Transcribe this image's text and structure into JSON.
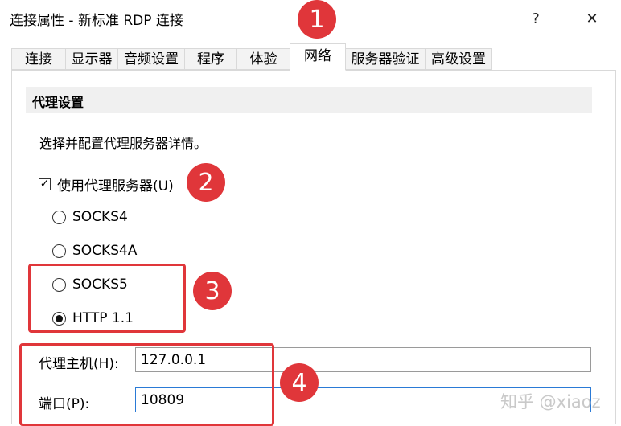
{
  "window": {
    "title": "连接属性 - 新标准 RDP 连接",
    "help_label": "?",
    "close_label": "✕"
  },
  "tabs": [
    {
      "label": "连接"
    },
    {
      "label": "显示器"
    },
    {
      "label": "音频设置"
    },
    {
      "label": "程序"
    },
    {
      "label": "体验"
    },
    {
      "label": "网络"
    },
    {
      "label": "服务器验证"
    },
    {
      "label": "高级设置"
    }
  ],
  "active_tab": "网络",
  "proxy": {
    "section_title": "代理设置",
    "description": "选择并配置代理服务器详情。",
    "use_proxy_label": "使用代理服务器(U)",
    "use_proxy_checked": true,
    "protocols": [
      {
        "label": "SOCKS4",
        "selected": false
      },
      {
        "label": "SOCKS4A",
        "selected": false
      },
      {
        "label": "SOCKS5",
        "selected": false
      },
      {
        "label": "HTTP 1.1",
        "selected": true
      }
    ],
    "host_label": "代理主机(H):",
    "host_value": "127.0.0.1",
    "port_label": "端口(P):",
    "port_value": "10809"
  },
  "annotations": {
    "badge_1": "1",
    "badge_2": "2",
    "badge_3": "3",
    "badge_4": "4",
    "color": "#e0363a"
  },
  "watermark": "知乎 @xiaoz"
}
